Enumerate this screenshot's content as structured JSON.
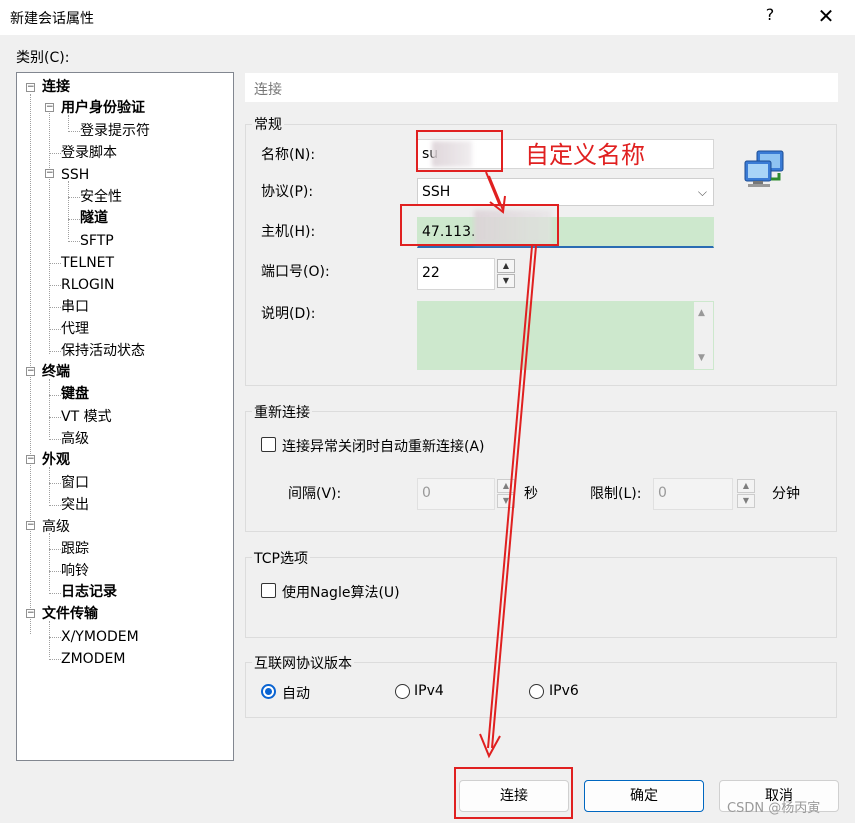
{
  "window": {
    "title": "新建会话属性",
    "help": "?",
    "close": "✕"
  },
  "category_label": "类别(C):",
  "tree": {
    "items": [
      {
        "label": "连接",
        "bold": true
      },
      {
        "label": "用户身份验证",
        "bold": true
      },
      {
        "label": "登录提示符",
        "bold": false
      },
      {
        "label": "登录脚本",
        "bold": false
      },
      {
        "label": "SSH",
        "bold": false
      },
      {
        "label": "安全性",
        "bold": false
      },
      {
        "label": "隧道",
        "bold": true
      },
      {
        "label": "SFTP",
        "bold": false
      },
      {
        "label": "TELNET",
        "bold": false
      },
      {
        "label": "RLOGIN",
        "bold": false
      },
      {
        "label": "串口",
        "bold": false
      },
      {
        "label": "代理",
        "bold": false
      },
      {
        "label": "保持活动状态",
        "bold": false
      },
      {
        "label": "终端",
        "bold": true
      },
      {
        "label": "键盘",
        "bold": true
      },
      {
        "label": "VT 模式",
        "bold": false
      },
      {
        "label": "高级",
        "bold": false
      },
      {
        "label": "外观",
        "bold": true
      },
      {
        "label": "窗口",
        "bold": false
      },
      {
        "label": "突出",
        "bold": false
      },
      {
        "label": "高级",
        "bold": false
      },
      {
        "label": "跟踪",
        "bold": false
      },
      {
        "label": "响铃",
        "bold": false
      },
      {
        "label": "日志记录",
        "bold": true
      },
      {
        "label": "文件传输",
        "bold": true
      },
      {
        "label": "X/YMODEM",
        "bold": false
      },
      {
        "label": "ZMODEM",
        "bold": false
      }
    ]
  },
  "section_title": "连接",
  "general": {
    "title": "常规",
    "name_label": "名称(N):",
    "name_value": "su",
    "protocol_label": "协议(P):",
    "protocol_value": "SSH",
    "host_label": "主机(H):",
    "host_value": "47.113.",
    "port_label": "端口号(O):",
    "port_value": "22",
    "desc_label": "说明(D):",
    "desc_value": ""
  },
  "reconnect": {
    "title": "重新连接",
    "checkbox_label": "连接异常关闭时自动重新连接(A)",
    "interval_label": "间隔(V):",
    "interval_value": "0",
    "interval_unit": "秒",
    "limit_label": "限制(L):",
    "limit_value": "0",
    "limit_unit": "分钟"
  },
  "tcp": {
    "title": "TCP选项",
    "checkbox_label": "使用Nagle算法(U)"
  },
  "ip_version": {
    "title": "互联网协议版本",
    "options": [
      "自动",
      "IPv4",
      "IPv6"
    ],
    "selected": "自动"
  },
  "buttons": {
    "connect": "连接",
    "ok": "确定",
    "cancel": "取消"
  },
  "annotation": "自定义名称",
  "watermark": "CSDN @杨丙寅",
  "colors": {
    "annotation": "#e02020",
    "host_field": "#cde8cd",
    "primary_border": "#0067c0"
  }
}
